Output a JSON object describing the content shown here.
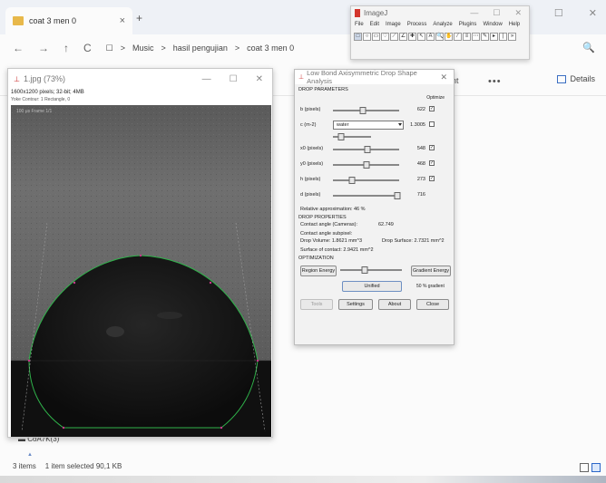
{
  "explorer": {
    "tab_title": "coat 3 men 0",
    "tab_close": "×",
    "new_tab": "+",
    "window_controls": [
      "—",
      "☐",
      "✕"
    ],
    "nav_icons": [
      "←",
      "→",
      "↑",
      "C",
      "☐"
    ],
    "breadcrumbs": [
      "Music",
      "hasil pengujian",
      "coat 3 men 0"
    ],
    "breadcrumb_sep": ">",
    "sort_label": "ht",
    "more_label": "•••",
    "details_label": "Details",
    "search_icon": "🔍",
    "status": {
      "items_count": "3 items",
      "selection": "1 item selected  90,1 KB"
    },
    "below_image_label": "▬ CoA7K(3)",
    "below_arrow": "▲"
  },
  "image_window": {
    "title": "1.jpg (73%)",
    "info_line": "1600x1200 pixels; 32-bit; 4MB",
    "info_line2": "Yoke Contour: 1 Rectangle, 0",
    "watermark": "100 μs  Frame 1/1",
    "window_controls": [
      "—",
      "☐",
      "✕"
    ]
  },
  "imagej": {
    "title": "ImageJ",
    "window_controls": [
      "—",
      "☐",
      "✕"
    ],
    "menu": [
      "File",
      "Edit",
      "Image",
      "Process",
      "Analyze",
      "Plugins",
      "Window",
      "Help"
    ],
    "tools": [
      "□",
      "○",
      "▭",
      "♡",
      "⟋",
      "∠",
      "✚",
      "↖",
      "A",
      "🔍",
      "✋",
      "⁄",
      "≡",
      "⋯",
      "✎",
      "▸",
      "|",
      "»"
    ]
  },
  "dialog": {
    "title": "Low Bond Axisymmetric Drop Shape Analysis",
    "close": "✕",
    "drop_parameters_label": "DROP PARAMETERS",
    "optimize_label": "Optimize",
    "params": [
      {
        "label": "b (pixels)",
        "value": "622",
        "checked": true,
        "pos": 0.45
      },
      {
        "label": "x0 (pixels)",
        "value": "548",
        "checked": true,
        "pos": 0.52
      },
      {
        "label": "y0 (pixels)",
        "value": "468",
        "checked": true,
        "pos": 0.5
      },
      {
        "label": "h (pixels)",
        "value": "273",
        "checked": true,
        "pos": 0.28
      },
      {
        "label": "d (pixels)",
        "value": "716",
        "checked": false,
        "pos": 0.98
      }
    ],
    "c_param": {
      "label": "c (m-2)",
      "select_value": "water",
      "value": "1.3005",
      "checked": false
    },
    "c_mini_pos": 0.2,
    "relative_approx": "Relative approximation: 46 %",
    "drop_properties_label": "DROP PROPERTIES",
    "contact_angle_label": "Contact angle (Cameras):",
    "contact_angle_value": "62.749",
    "contact_angle_subpixel": "Contact angle subpixel:",
    "drop_volume": "Drop Volume: 1.8621 mm^3",
    "drop_surface": "Drop Surface: 2.7321 mm^2",
    "surface_contact": "Surface of contact: 2.9421 mm^2",
    "optimization_label": "OPTIMIZATION",
    "region_energy_btn": "Region Energy",
    "gradient_energy_btn": "Gradient Energy",
    "opt_slider_pos": 0.4,
    "unified_btn": "Unified",
    "gradient_pct": "50 % gradient",
    "tabs": {
      "tools": "Tools",
      "settings": "Settings",
      "about": "About",
      "close": "Close"
    }
  },
  "colors": {
    "fit_curve": "#2fb24a",
    "folder": "#e8b84a",
    "accent": "#2a66c8"
  }
}
